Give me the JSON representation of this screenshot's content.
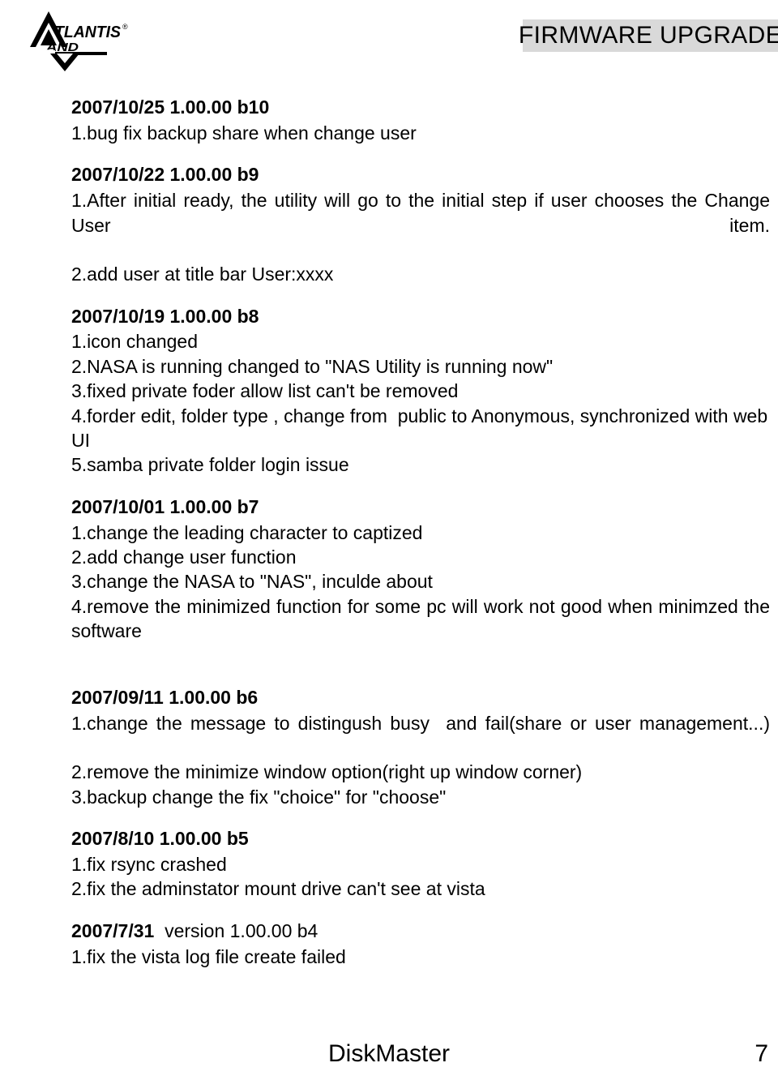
{
  "header": {
    "logo": {
      "name": "atlantis-land-logo",
      "line1": "TLANTIS",
      "registered": "®",
      "line2": "AND"
    },
    "title": "FIRMWARE UPGRADE",
    "title_highlight_color": "#d9d9d9"
  },
  "releases": [
    {
      "heading": "2007/10/25 1.00.00 b10",
      "items": [
        "1.bug fix backup share when change user"
      ]
    },
    {
      "heading": "2007/10/22 1.00.00 b9",
      "items": [
        "1.After initial ready, the utility will go to the initial step if user chooses the Change User item.",
        "2.add user at title bar User:xxxx"
      ]
    },
    {
      "heading": "2007/10/19 1.00.00 b8",
      "items": [
        "1.icon changed",
        "2.NASA is running changed to \"NAS Utility is running now\"",
        "3.fixed private foder allow list can't be removed",
        "4.forder edit, folder type , change from  public to Anonymous, synchronized with web UI",
        "5.samba private folder login issue"
      ]
    },
    {
      "heading": "2007/10/01 1.00.00 b7",
      "items": [
        "1.change the leading character to captized",
        "2.add change user function",
        "3.change the NASA to \"NAS\", inculde about",
        "4.remove the minimized function for some pc will work not good when minimzed the software"
      ]
    },
    {
      "heading": "2007/09/11 1.00.00 b6",
      "items": [
        "1.change the message to distingush busy  and fail(share or user management...)",
        "2.remove the minimize window option(right up window corner)",
        "3.backup change the fix \"choice\" for \"choose\""
      ]
    },
    {
      "heading": "2007/8/10 1.00.00 b5",
      "items": [
        "1.fix rsync crashed",
        "2.fix the adminstator mount drive can't see at vista"
      ]
    },
    {
      "heading": "2007/7/31 ",
      "heading_regular": " version 1.00.00 b4",
      "items": [
        "1.fix the vista log file create failed"
      ]
    }
  ],
  "footer": {
    "product": "DiskMaster",
    "page_number": "7"
  }
}
